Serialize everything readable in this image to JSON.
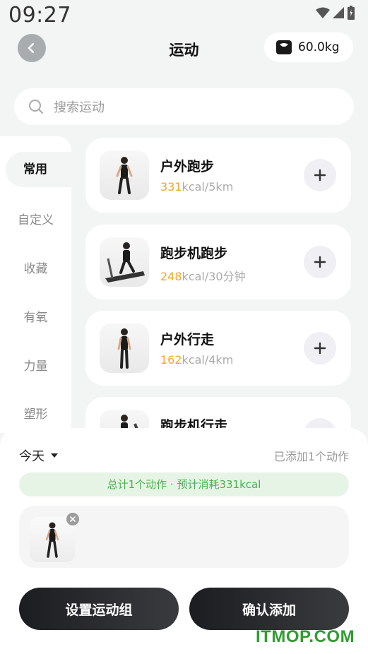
{
  "status_bar": {
    "time": "09:27"
  },
  "header": {
    "title": "运动",
    "weight": "60.0kg"
  },
  "search": {
    "placeholder": "搜索运动"
  },
  "sidebar": {
    "items": [
      {
        "label": "常用",
        "active": true
      },
      {
        "label": "自定义"
      },
      {
        "label": "收藏"
      },
      {
        "label": "有氧"
      },
      {
        "label": "力量"
      },
      {
        "label": "塑形"
      }
    ]
  },
  "exercises": [
    {
      "name": "户外跑步",
      "calories": "331",
      "unit": "kcal/5km",
      "image": "runner-image"
    },
    {
      "name": "跑步机跑步",
      "calories": "248",
      "unit": "kcal/30分钟",
      "image": "treadmill-runner-image"
    },
    {
      "name": "户外行走",
      "calories": "162",
      "unit": "kcal/4km",
      "image": "walker-image"
    },
    {
      "name": "跑步机行走",
      "calories": "",
      "unit": "",
      "image": "treadmill-walker-image"
    }
  ],
  "sheet": {
    "day": "今天",
    "added_count": "已添加1个动作",
    "summary": "总计1个动作 · 预计消耗331kcal",
    "set_group_label": "设置运动组",
    "confirm_label": "确认添加"
  },
  "watermark": "ITMOP.COM",
  "colors": {
    "accent_orange": "#f5a623",
    "summary_green": "#4caf50",
    "button_dark": "#1c1d20"
  }
}
